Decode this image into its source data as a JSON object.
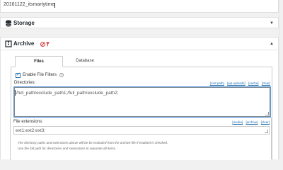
{
  "top_input": {
    "value": "20161122_itsmartytime"
  },
  "storage_panel": {
    "title": "Storage",
    "toggle_icon": "caret-down-icon"
  },
  "archive_panel": {
    "title": "Archive",
    "toggle_icon": "caret-up-icon",
    "badge_icon": "filter-icon",
    "tabs": [
      {
        "label": "Files",
        "active": true
      },
      {
        "label": "Database",
        "active": false
      }
    ],
    "files": {
      "enable_filters_label": "Enable File Filters",
      "enable_filters_checked": true,
      "directories_label": "Directories:",
      "directories_links": [
        "[root path]",
        "[wp-uploads]",
        "[cache]",
        "[clear]"
      ],
      "directories_value": "/full_path/exclude_path1;/full_path/exclude_path2;",
      "extensions_label": "File extensions:",
      "extensions_links": [
        "[media]",
        "[archive]",
        "[clear]"
      ],
      "extensions_value": "ext1;ext2;ext3;",
      "note_line1": "The directory paths and extensions above will be be excluded from the archive file if enabled is checked.",
      "note_line2": "Use the full path for directories and semicolons to separate all items."
    }
  },
  "colors": {
    "link": "#2271b1",
    "filter_badge": "#d63638"
  }
}
